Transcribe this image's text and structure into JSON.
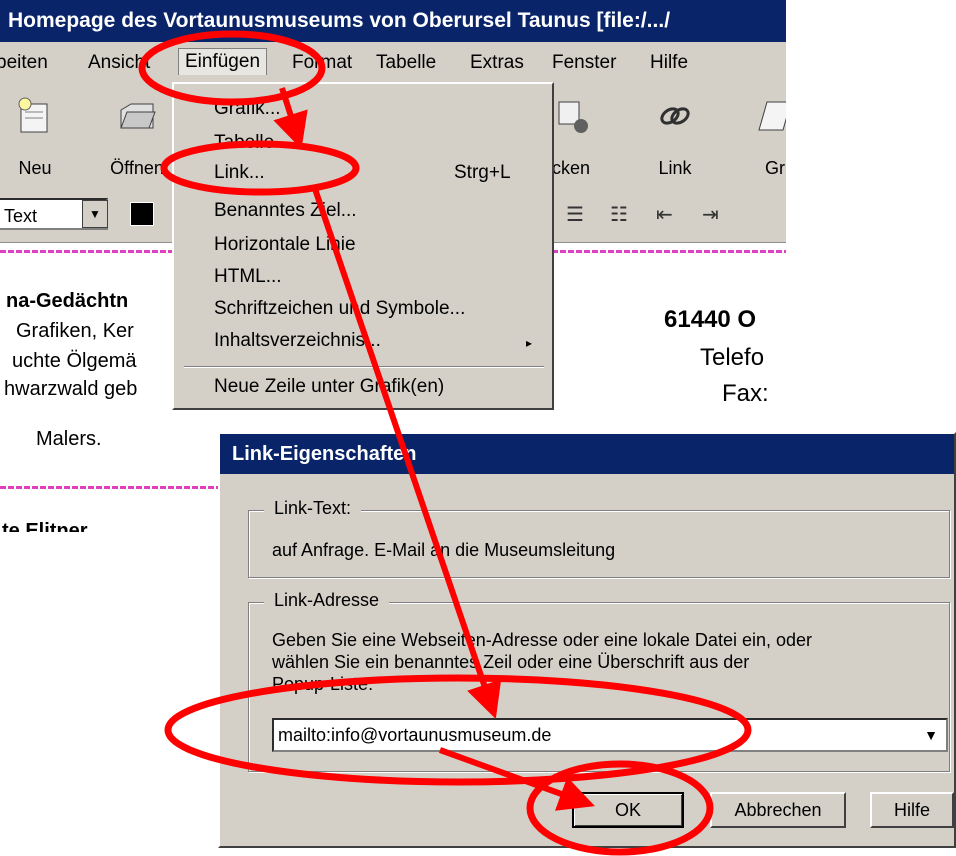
{
  "window": {
    "title": "Homepage des Vortaunusmuseums von Oberursel Taunus [file:/.../"
  },
  "menubar": {
    "items": [
      "beiten",
      "Ansicht",
      "Einfügen",
      "Format",
      "Tabelle",
      "Extras",
      "Fenster",
      "Hilfe"
    ]
  },
  "toolbar": {
    "buttons": [
      {
        "label": "Neu",
        "icon": "new-document-icon"
      },
      {
        "label": "Öffnen",
        "icon": "open-folder-icon"
      },
      {
        "label": "cken",
        "icon": "print-icon"
      },
      {
        "label": "Link",
        "icon": "link-icon"
      },
      {
        "label": "Gr",
        "icon": "image-icon"
      }
    ]
  },
  "formatbar": {
    "style_value": "Text"
  },
  "content": {
    "left_lines": [
      "na-Gedächtn",
      "Grafiken, Ker",
      "uchte Ölgemä",
      "hwarzwald geb",
      "Malers.",
      "te Elitner"
    ],
    "right_lines": [
      "61440 O",
      "Telefo",
      "Fax:"
    ]
  },
  "dropdown": {
    "items": [
      {
        "label": "Grafik..."
      },
      {
        "label": "Tabelle"
      },
      {
        "label": "Link...",
        "shortcut": "Strg+L"
      },
      {
        "label": "Benanntes Ziel..."
      },
      {
        "label": "Horizontale Linie"
      },
      {
        "label": "HTML..."
      },
      {
        "label": "Schriftzeichen und Symbole..."
      },
      {
        "label": "Inhaltsverzeichnis...",
        "submenu": "▸"
      },
      {
        "label": "Neue Zeile unter Grafik(en)"
      }
    ]
  },
  "dialog": {
    "title": "Link-Eigenschaften",
    "link_text_legend": "Link-Text:",
    "link_text_value": "auf Anfrage. E-Mail an die Museumsleitung",
    "link_address_legend": "Link-Adresse",
    "help_line1": "Geben Sie eine Webseiten-Adresse oder eine lokale Datei ein, oder",
    "help_line2": "wählen Sie ein benanntes Zeil oder eine Überschrift aus der",
    "help_line3": "Popup-Liste:",
    "address_value": "mailto:info@vortaunusmuseum.de",
    "ok_label": "OK",
    "cancel_label": "Abbrechen",
    "help_label": "Hilfe"
  },
  "colors": {
    "annotation": "#ff0000",
    "titlebar": "#0a246a",
    "chrome": "#d4d0c8"
  }
}
